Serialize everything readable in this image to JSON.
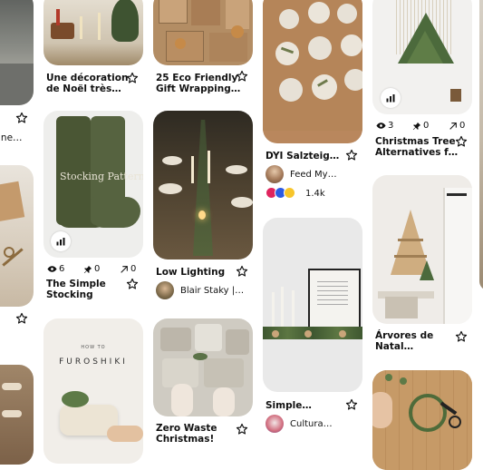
{
  "pins": {
    "noel": {
      "title_line1": "Une décoration",
      "title_line2": "de Noël très…"
    },
    "eco": {
      "title_line1": "25 Eco Friendly",
      "title_line2": "Gift Wrapping…"
    },
    "salz": {
      "title": "DYI Salzteig…",
      "author": "Feed My…",
      "reaction_count": "1.4k"
    },
    "tree": {
      "views": "3",
      "saves": "0",
      "shares": "0",
      "title_line1": "Christmas Tree",
      "title_line2": "Alternatives f…"
    },
    "left_top": {
      "caption": "ine…"
    },
    "stocking": {
      "image_text_main": "Stocking Pattern",
      "views": "6",
      "saves": "0",
      "shares": "0",
      "title_line1": "The Simple",
      "title_line2": "Stocking"
    },
    "lighting": {
      "title": "Low Lighting",
      "author": "Blair Staky |…"
    },
    "simple": {
      "title": "Simple…",
      "author": "Cultura…"
    },
    "arvores": {
      "title_line1": "Árvores de",
      "title_line2": "Natal…"
    },
    "furoshiki": {
      "image_small": "HOW TO",
      "image_big": "FUROSHIKI"
    },
    "zerowaste": {
      "title_line1": "Zero Waste",
      "title_line2": "Christmas!"
    }
  },
  "colors": {
    "text": "#111111",
    "background": "#ffffff",
    "stocking_green": "#4a5634",
    "kraft": "#b8875c"
  },
  "icons": [
    "star-icon",
    "eye-icon",
    "pin-icon",
    "share-arrow-icon",
    "stats-icon"
  ]
}
